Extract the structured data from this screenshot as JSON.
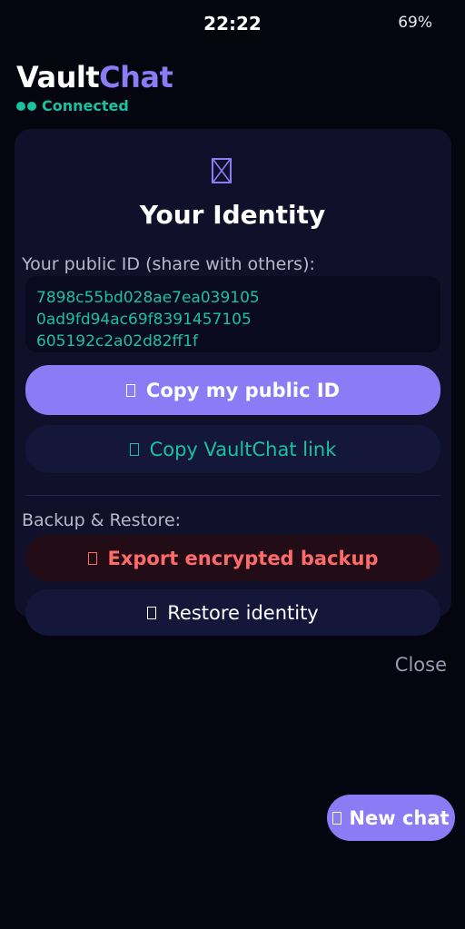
{
  "status_bar": {
    "time": "22:22",
    "battery": "69%"
  },
  "header": {
    "brand_part1": "Vault",
    "brand_part2": "Chat",
    "connection_status": "Connected"
  },
  "identity": {
    "title": "Your Identity",
    "public_id_label": "Your public ID (share with others):",
    "public_id_lines": [
      "7898c55bd028ae7ea039105",
      "0ad9fd94ac69f8391457105",
      "605192c2a02d82ff1f"
    ],
    "copy_id_label": "Copy my public ID",
    "copy_link_label": "Copy VaultChat link",
    "backup_label": "Backup & Restore:",
    "export_label": "Export encrypted backup",
    "restore_label": "Restore identity",
    "close_label": "Close"
  },
  "fab": {
    "new_chat_label": "New chat"
  },
  "colors": {
    "background": "#05050f",
    "card": "#10102b",
    "accent": "#8b7cf6",
    "teal": "#19c2a0",
    "danger": "#ff6b6b"
  },
  "icons": {
    "identity": "missing-glyph-icon",
    "copy_id": "missing-glyph-icon",
    "copy_link": "missing-glyph-icon",
    "export": "missing-glyph-icon",
    "restore": "missing-glyph-icon",
    "new_chat": "missing-glyph-icon"
  }
}
